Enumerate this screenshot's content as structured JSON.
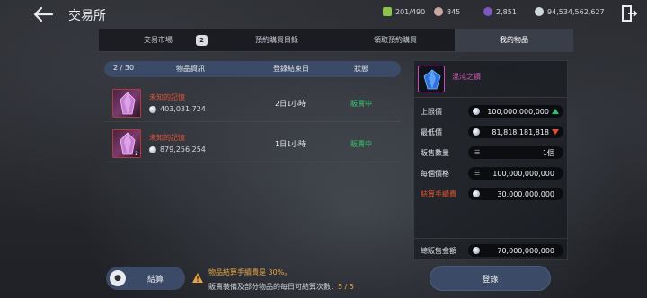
{
  "header": {
    "title": "交易所",
    "resources": [
      {
        "icon": "energy-icon",
        "value": "201/490",
        "color": "#8bc34a"
      },
      {
        "icon": "gem-icon",
        "value": "845",
        "color": "#c9a6a0"
      },
      {
        "icon": "crystal-icon",
        "value": "2,851",
        "color": "#7e57c2"
      },
      {
        "icon": "silver-coin-icon",
        "value": "94,534,562,627",
        "color": "#cfd8dc"
      }
    ]
  },
  "tabs": [
    {
      "label": "交易市場",
      "badge": "2"
    },
    {
      "label": "預約購買目錄"
    },
    {
      "label": "領取預約購買"
    },
    {
      "label": "我的物品",
      "active": true
    }
  ],
  "list": {
    "page": "2 / 30",
    "columns": [
      "物品資訊",
      "登錄結束日",
      "狀態"
    ],
    "rows": [
      {
        "name": "未知的記憶",
        "price": "403,031,724",
        "end": "2日1小時",
        "status": "販賣中",
        "qty": ""
      },
      {
        "name": "未知的記憶",
        "price": "879,256,254",
        "end": "1日1小時",
        "status": "販賣中",
        "qty": "2"
      }
    ]
  },
  "detail": {
    "item_name": "混沌之鑽",
    "max_price_label": "上限價",
    "max_price": "100,000,000,000",
    "min_price_label": "最低價",
    "min_price": "81,818,181,818",
    "quantity_label": "販售數量",
    "quantity": "1個",
    "unit_price_label": "每個價格",
    "unit_price": "100,000,000,000",
    "fee_label": "結算手續費",
    "fee": "30,000,000,000",
    "total_label": "總販售金額",
    "total": "70,000,000,000"
  },
  "bottom": {
    "settle_label": "結算",
    "notice_fee": "物品結算手續費是 30%。",
    "notice_limit": "販賣裝備及部分物品的每日可結算次數：",
    "settle_count": "5 / 5",
    "register_label": "登錄"
  }
}
